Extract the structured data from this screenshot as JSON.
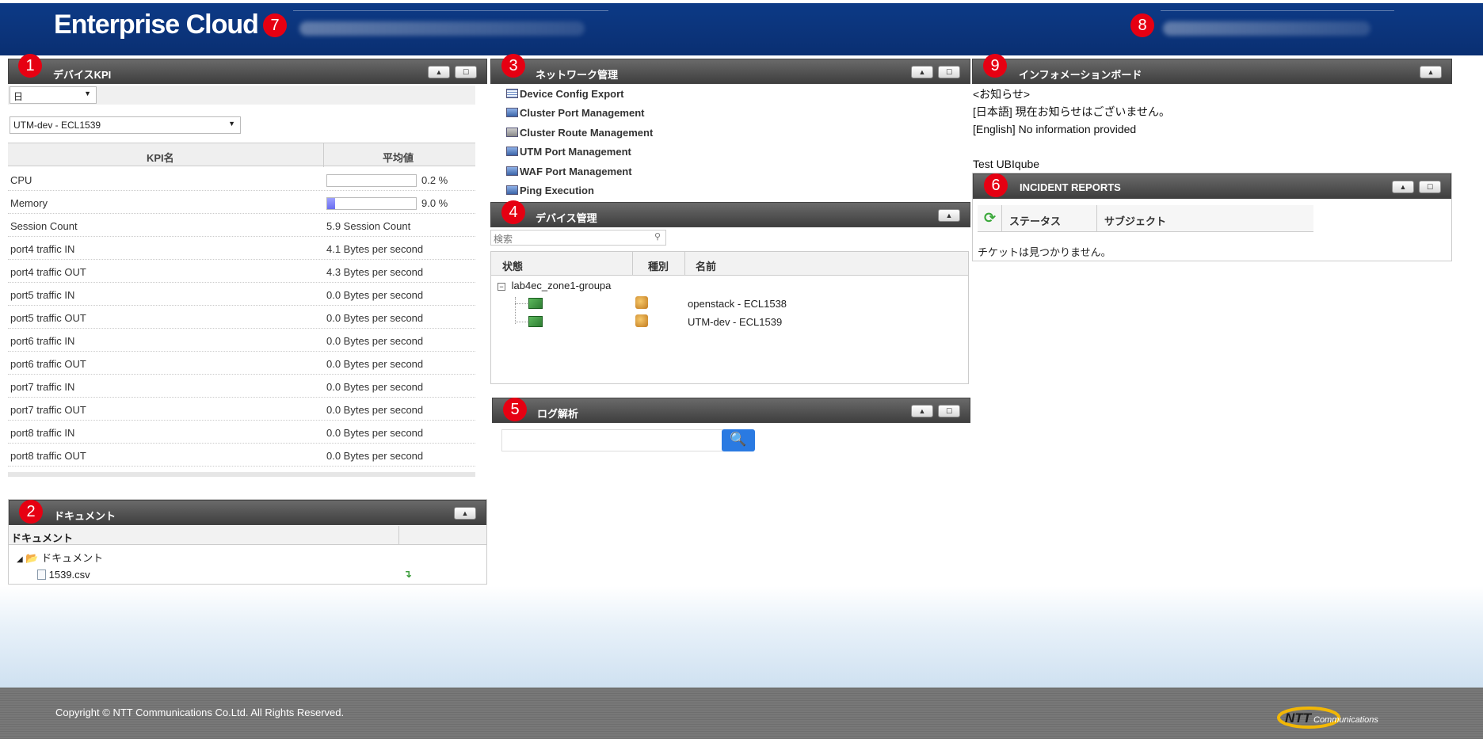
{
  "header": {
    "brand": "Enterprise Cloud",
    "badges": {
      "b7": "7",
      "b8": "8"
    }
  },
  "kpi_panel": {
    "badge": "1",
    "title": "デバイスKPI",
    "period_select": "日",
    "device_select": "UTM-dev - ECL1539",
    "columns": [
      "KPI名",
      "平均値"
    ],
    "rows": [
      {
        "name": "CPU",
        "value": "0.2 %",
        "fill": 0.002
      },
      {
        "name": "Memory",
        "value": "9.0 %",
        "fill": 0.09
      },
      {
        "name": "Session Count",
        "value": "5.9 Session Count"
      },
      {
        "name": "port4 traffic IN",
        "value": "4.1 Bytes per second"
      },
      {
        "name": "port4 traffic OUT",
        "value": "4.3 Bytes per second"
      },
      {
        "name": "port5 traffic IN",
        "value": "0.0 Bytes per second"
      },
      {
        "name": "port5 traffic OUT",
        "value": "0.0 Bytes per second"
      },
      {
        "name": "port6 traffic IN",
        "value": "0.0 Bytes per second"
      },
      {
        "name": "port6 traffic OUT",
        "value": "0.0 Bytes per second"
      },
      {
        "name": "port7 traffic IN",
        "value": "0.0 Bytes per second"
      },
      {
        "name": "port7 traffic OUT",
        "value": "0.0 Bytes per second"
      },
      {
        "name": "port8 traffic IN",
        "value": "0.0 Bytes per second"
      },
      {
        "name": "port8 traffic OUT",
        "value": "0.0 Bytes per second"
      }
    ]
  },
  "doc_panel": {
    "badge": "2",
    "title": "ドキュメント",
    "column": "ドキュメント",
    "folder": "ドキュメント",
    "file": "1539.csv"
  },
  "network_panel": {
    "badge": "3",
    "title": "ネットワーク管理",
    "items": [
      {
        "label": "Device Config Export",
        "icon": "document-list-icon"
      },
      {
        "label": "Cluster Port Management",
        "icon": "server-icon"
      },
      {
        "label": "Cluster Route Management",
        "icon": "router-icon"
      },
      {
        "label": "UTM Port Management",
        "icon": "server-icon"
      },
      {
        "label": "WAF Port Management",
        "icon": "server-icon"
      },
      {
        "label": "Ping Execution",
        "icon": "server-icon"
      }
    ]
  },
  "device_panel": {
    "badge": "4",
    "title": "デバイス管理",
    "search_placeholder": "検索",
    "columns": [
      "状態",
      "種別",
      "名前"
    ],
    "group": "lab4ec_zone1-groupa",
    "devices": [
      {
        "name": "openstack - ECL1538"
      },
      {
        "name": "UTM-dev - ECL1539"
      }
    ]
  },
  "log_panel": {
    "badge": "5",
    "title": "ログ解析",
    "search_value": ""
  },
  "incident_panel": {
    "badge": "6",
    "title": "INCIDENT REPORTS",
    "columns": [
      "ステータス",
      "サブジェクト"
    ],
    "empty": "チケットは見つかりません。"
  },
  "info_panel": {
    "badge": "9",
    "title": "インフォメーションボード",
    "lines": [
      "<お知らせ>",
      "[日本語] 現在お知らせはございません。",
      "[English] No information provided",
      "",
      "Test UBIqube"
    ]
  },
  "footer": {
    "copyright": "Copyright © NTT Communications Co.Ltd. All Rights Reserved.",
    "logo_text": "NTT",
    "logo_sub": "Communications"
  },
  "colors": {
    "header": "#0a2f72",
    "badge": "#e60012",
    "panel_head": "#4a4a4a",
    "search_button": "#2a7ae2"
  }
}
